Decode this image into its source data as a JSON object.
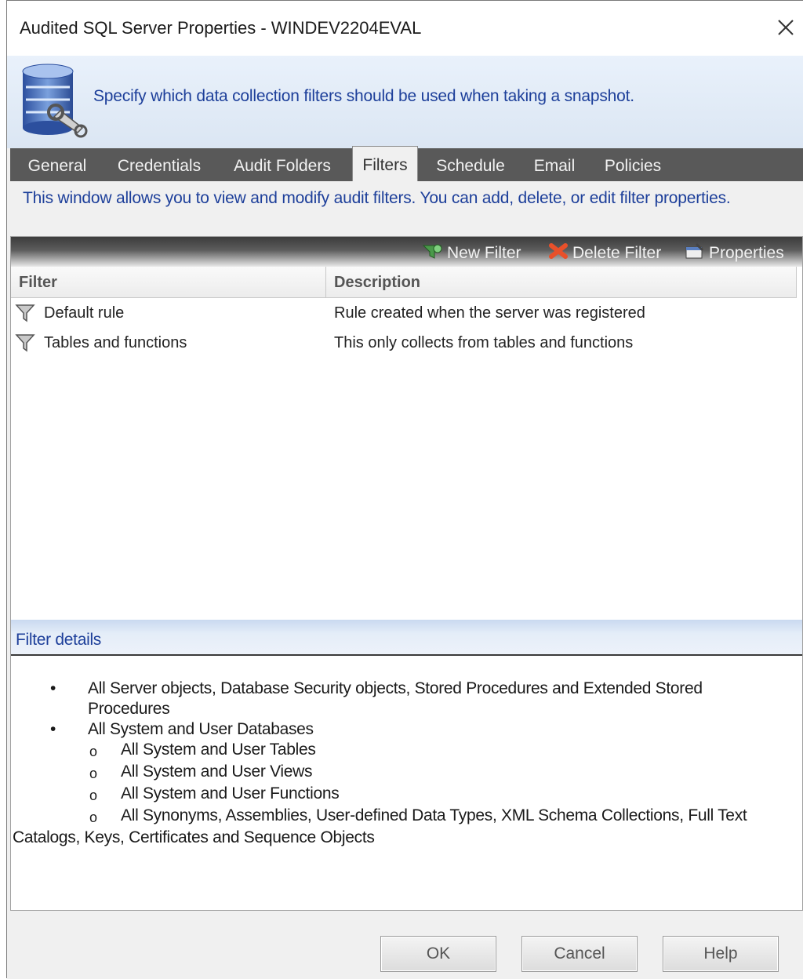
{
  "window": {
    "title": "Audited SQL Server Properties - WINDEV2204EVAL",
    "close_label": "Close"
  },
  "header": {
    "text": "Specify which data collection filters should be used when taking a snapshot."
  },
  "tabs": [
    {
      "label": "General"
    },
    {
      "label": "Credentials"
    },
    {
      "label": "Audit Folders"
    },
    {
      "label": "Filters",
      "active": true
    },
    {
      "label": "Schedule"
    },
    {
      "label": "Email"
    },
    {
      "label": "Policies"
    }
  ],
  "description": "This window allows you to view and modify audit filters.  You can add, delete, or edit filter properties.",
  "toolbar": {
    "new_filter": "New Filter",
    "delete_filter": "Delete Filter",
    "properties": "Properties"
  },
  "filters_table": {
    "columns": [
      "Filter",
      "Description"
    ],
    "rows": [
      {
        "filter": "Default rule",
        "description": "Rule created when the server was registered"
      },
      {
        "filter": "Tables and functions",
        "description": "This only collects from tables and functions"
      }
    ]
  },
  "filter_details": {
    "heading": "Filter details",
    "bullets": [
      "All Server objects, Database Security objects, Stored Procedures and Extended Stored",
      "Procedures",
      "All System and User Databases"
    ],
    "sub_items": [
      "All System and User Tables",
      "All System and User Views",
      "All System and User Functions",
      "All Synonyms, Assemblies, User-defined Data Types, XML Schema Collections, Full Text"
    ],
    "wrap_line": "Catalogs, Keys, Certificates and Sequence Objects"
  },
  "buttons": {
    "ok": "OK",
    "cancel": "Cancel",
    "help": "Help"
  },
  "colors": {
    "accent_text": "#1d3f9a",
    "tab_bar": "#595959",
    "delete_icon": "#e8502a",
    "new_icon": "#3a8a3a"
  }
}
